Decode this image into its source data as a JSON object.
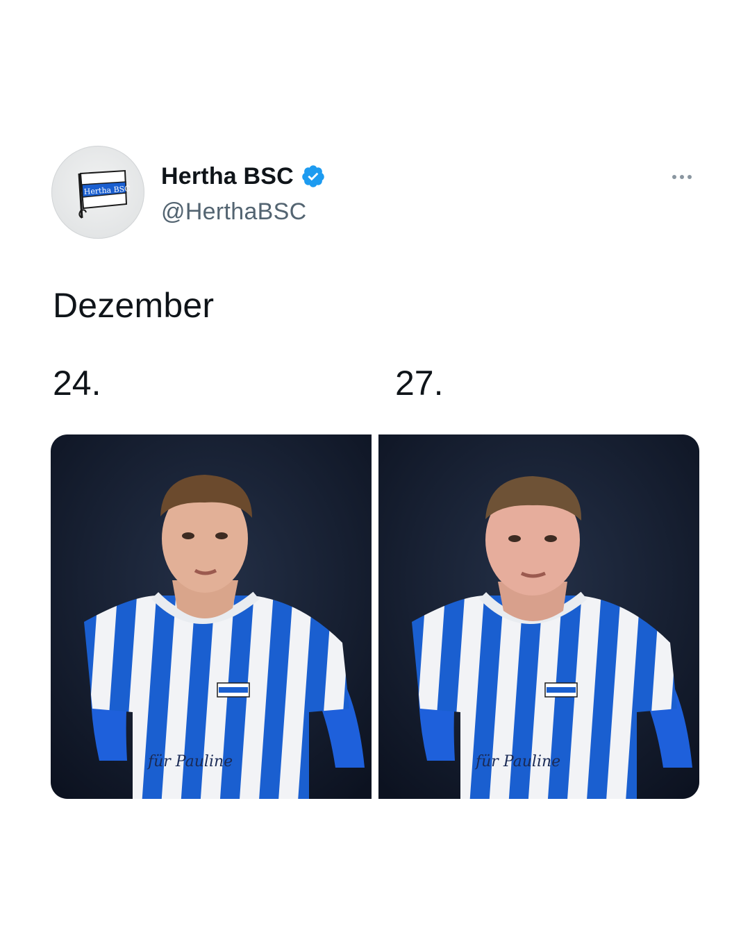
{
  "author": {
    "display_name": "Hertha BSC",
    "handle": "@HerthaBSC",
    "verified": true,
    "avatar_icon": "hertha-flag-logo-icon",
    "avatar_logo_text": "Hertha BSC"
  },
  "menu": {
    "icon": "more-options-icon"
  },
  "tweet": {
    "text": "Dezember",
    "dates": [
      "24.",
      "27."
    ]
  },
  "media": [
    {
      "description_icon": "player-photo",
      "shirt_sponsor": "für Pauline"
    },
    {
      "description_icon": "player-photo",
      "shirt_sponsor": "für Pauline"
    }
  ],
  "colors": {
    "hertha_blue": "#1a5fd0",
    "verified_blue": "#1d9bf0",
    "text_primary": "#0f1419",
    "text_secondary": "#536471",
    "photo_background": "#141d2e"
  }
}
